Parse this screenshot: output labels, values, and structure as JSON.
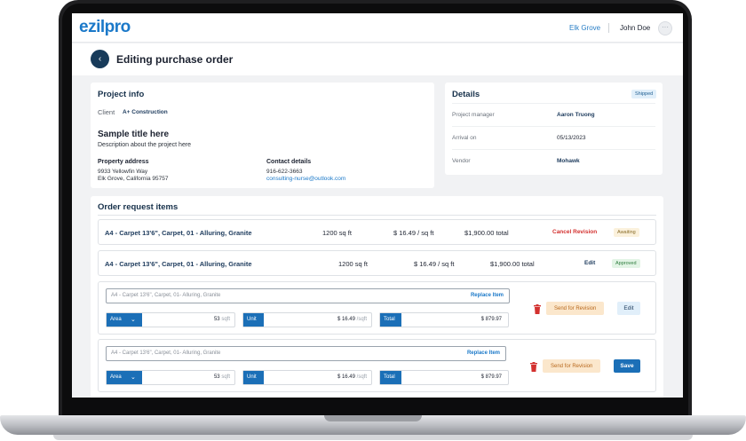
{
  "app": {
    "logo": "ezilpro",
    "location": "Elk Grove",
    "user_name": "John Doe",
    "avatar_glyph": "···"
  },
  "page": {
    "back_glyph": "‹",
    "title": "Editing purchase order"
  },
  "project_info": {
    "title": "Project info",
    "client_label": "Client",
    "client_value": "A+ Construction",
    "sample_title": "Sample title here",
    "sample_description": "Description about the project here",
    "property_label": "Property address",
    "address_line1": "9933 Yellowfin Way",
    "address_line2": "Elk Grove, California 95757",
    "contact_label": "Contact details",
    "phone": "916-622-3663",
    "email": "consulting-nurse@outlook.com"
  },
  "details": {
    "title": "Details",
    "status": "Shipped",
    "rows": [
      {
        "key": "Project manager",
        "value": "Aaron Truong"
      },
      {
        "key": "Arrival on",
        "value": "05/13/2023"
      },
      {
        "key": "Vendor",
        "value": "Mohawk"
      }
    ]
  },
  "order": {
    "title": "Order request items",
    "rows": [
      {
        "name": "A4 - Carpet 13'6\", Carpet, 01 - Alluring, Granite",
        "area": "1200 sq ft",
        "unit": "$ 16.49 / sq ft",
        "total": "$1,900.00 total",
        "action": "Cancel Revision",
        "status": "Awaiting"
      },
      {
        "name": "A4 - Carpet 13'6\", Carpet, 01 - Alluring, Granite",
        "area": "1200 sq ft",
        "unit": "$ 16.49 / sq ft",
        "total": "$1,900.00 total",
        "action": "Edit",
        "status": "Approved"
      }
    ],
    "edit_items": [
      {
        "item": "A4 - Carpet 13'6\", Carpet, 01- Alluring, Granite",
        "replace": "Replace Item",
        "area_label": "Area",
        "area_value": "53",
        "area_unit": "sqft",
        "unit_label": "Unit",
        "unit_value": "$ 16.49",
        "unit_unit": "/sqft",
        "total_label": "Total",
        "total_value": "$ 879.97",
        "send": "Send for Revision",
        "button": "Edit"
      },
      {
        "item": "A4 - Carpet 13'6\", Carpet, 01- Alluring, Granite",
        "replace": "Replace Item",
        "area_label": "Area",
        "area_value": "53",
        "area_unit": "sqft",
        "unit_label": "Unit",
        "unit_value": "$ 16.49",
        "unit_unit": "/sqft",
        "total_label": "Total",
        "total_value": "$ 879.97",
        "send": "Send for Revision",
        "button": "Save"
      }
    ]
  },
  "colors": {
    "brand": "#1b79c9",
    "navy": "#183b5a",
    "danger": "#d3312f",
    "warning_bg": "#fbe7cc",
    "success_bg": "#e2f4e5"
  }
}
